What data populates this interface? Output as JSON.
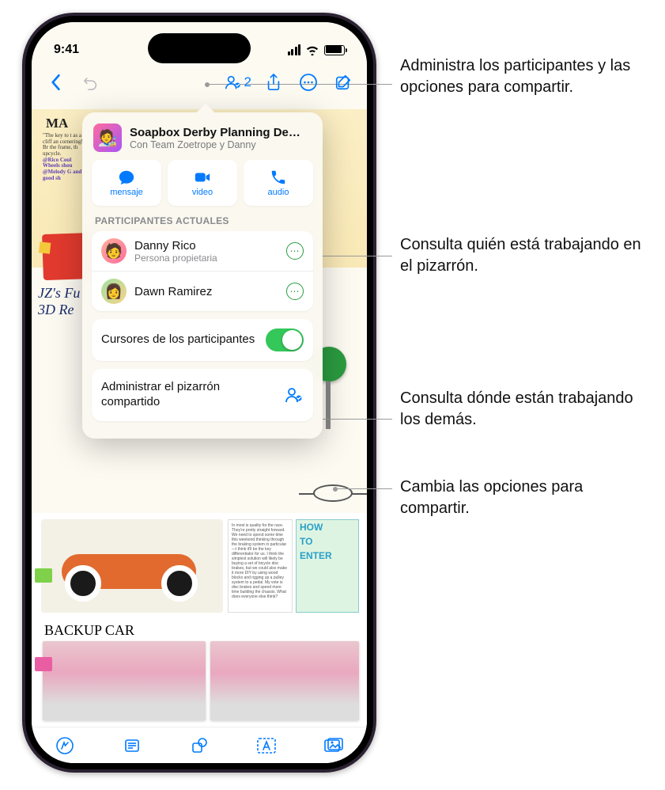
{
  "status": {
    "time": "9:41"
  },
  "toolbar": {
    "collab_count": "2"
  },
  "popover": {
    "title": "Soapbox Derby Planning De…",
    "subtitle": "Con Team Zoetrope y Danny",
    "comm": {
      "message": "mensaje",
      "video": "video",
      "audio": "audio"
    },
    "section_header": "PARTICIPANTES ACTUALES",
    "participants": [
      {
        "name": "Danny Rico",
        "role": "Persona propietaria"
      },
      {
        "name": "Dawn Ramirez",
        "role": ""
      }
    ],
    "cursors_label": "Cursores de los participantes",
    "cursors_on": true,
    "manage_label": "Administrar el pizarrón compartido"
  },
  "canvas": {
    "handwriting1": "MA",
    "handwriting2": "JZ's Fu\n3D Re",
    "backup_label": "BACKUP CAR",
    "howto_lines": [
      "HOW",
      "TO",
      "ENTER"
    ],
    "tiny_quote": "\"The key to t as a cliff an cornering! Br the frame, th upcycle.",
    "tiny_rico": "@Rico Coul Wheels shou",
    "tiny_melody": "@Melody G and good sh"
  },
  "callouts": {
    "c1": "Administra los participantes y las opciones para compartir.",
    "c2": "Consulta quién está trabajando en el pizarrón.",
    "c3": "Consulta dónde están trabajando los demás.",
    "c4": "Cambia las opciones para compartir."
  }
}
